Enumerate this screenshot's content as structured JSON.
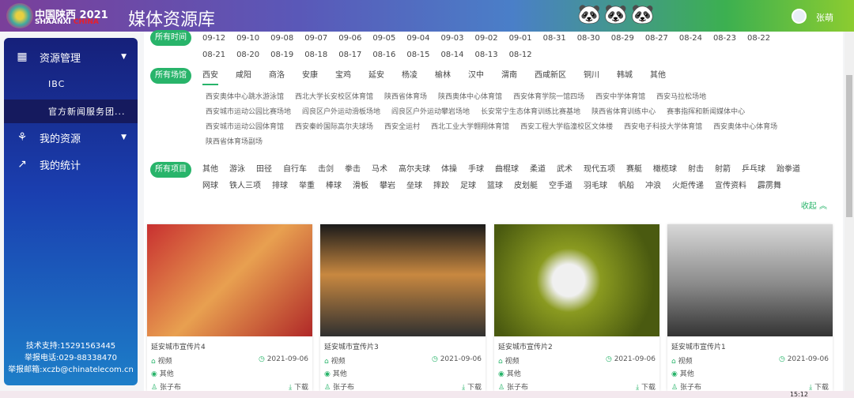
{
  "header": {
    "logo_line1": "中国陕西 2021",
    "logo_line2a": "SHAANXI",
    "logo_line2b": "CHINA",
    "title": "媒体资源库",
    "user": "张萌"
  },
  "sidebar": {
    "items": [
      {
        "label": "资源管理",
        "icon": "grid-icon"
      },
      {
        "label": "我的资源",
        "icon": "share-icon"
      },
      {
        "label": "我的统计",
        "icon": "chart-icon"
      }
    ],
    "subitems": [
      "IBC",
      "官方新闻服务团..."
    ],
    "footer": [
      "技术支持:15291563445",
      "举报电话:029-88338470",
      "举报邮箱:xczb@chinatelecom.cn"
    ]
  },
  "filters": {
    "time_label": "所有时间",
    "dates": [
      "09-12",
      "09-10",
      "09-08",
      "09-07",
      "09-06",
      "09-05",
      "09-04",
      "09-03",
      "09-02",
      "09-01",
      "08-31",
      "08-30",
      "08-29",
      "08-27",
      "08-24",
      "08-23",
      "08-22",
      "08-21",
      "08-20",
      "08-19",
      "08-18",
      "08-17",
      "08-16",
      "08-15",
      "08-14",
      "08-13",
      "08-12"
    ],
    "venue_label": "所有场馆",
    "cities": [
      "西安",
      "咸阳",
      "商洛",
      "安康",
      "宝鸡",
      "延安",
      "杨凌",
      "榆林",
      "汉中",
      "渭南",
      "西咸新区",
      "铜川",
      "韩城",
      "其他"
    ],
    "venues": [
      "西安奥体中心跳水游泳馆",
      "西北大学长安校区体育馆",
      "陕西省体育场",
      "陕西奥体中心体育馆",
      "西安体育学院一馆四场",
      "西安中学体育馆",
      "西安马拉松场地",
      "西安城市运动公园比赛场地",
      "阎良区户外运动滑板场地",
      "阎良区户外运动攀岩场地",
      "长安常宁生态体育训练比赛基地",
      "陕西省体育训练中心",
      "赛事指挥和新闻媒体中心",
      "西安城市运动公园体育馆",
      "西安秦岭国际高尔夫球场",
      "西安全运村",
      "西北工业大学翱翔体育馆",
      "西安工程大学临潼校区文体楼",
      "西安电子科技大学体育馆",
      "西安奥体中心体育场",
      "陕西省体育场副场"
    ],
    "project_label": "所有项目",
    "projects": [
      "其他",
      "游泳",
      "田径",
      "自行车",
      "击剑",
      "拳击",
      "马术",
      "高尔夫球",
      "体操",
      "手球",
      "曲棍球",
      "柔道",
      "武术",
      "现代五项",
      "赛艇",
      "橄榄球",
      "射击",
      "射箭",
      "乒乓球",
      "跆拳道",
      "网球",
      "铁人三项",
      "排球",
      "举重",
      "棒球",
      "滑板",
      "攀岩",
      "垒球",
      "摔跤",
      "足球",
      "篮球",
      "皮划艇",
      "空手道",
      "羽毛球",
      "帆船",
      "冲浪",
      "火炬传递",
      "宣传资料",
      "霹雳舞"
    ],
    "collapse": "收起"
  },
  "cards": [
    {
      "title": "延安城市宣传片4",
      "type": "视频",
      "date": "2021-09-06",
      "category": "其他",
      "author": "张子布",
      "download": "下载"
    },
    {
      "title": "延安城市宣传片3",
      "type": "视频",
      "date": "2021-09-06",
      "category": "其他",
      "author": "张子布",
      "download": "下载"
    },
    {
      "title": "延安城市宣传片2",
      "type": "视频",
      "date": "2021-09-06",
      "category": "其他",
      "author": "张子布",
      "download": "下载"
    },
    {
      "title": "延安城市宣传片1",
      "type": "视频",
      "date": "2021-09-06",
      "category": "其他",
      "author": "张子布",
      "download": "下载"
    }
  ],
  "taskbar": {
    "time": "15:12"
  },
  "colors": {
    "accent": "#28b46a"
  }
}
